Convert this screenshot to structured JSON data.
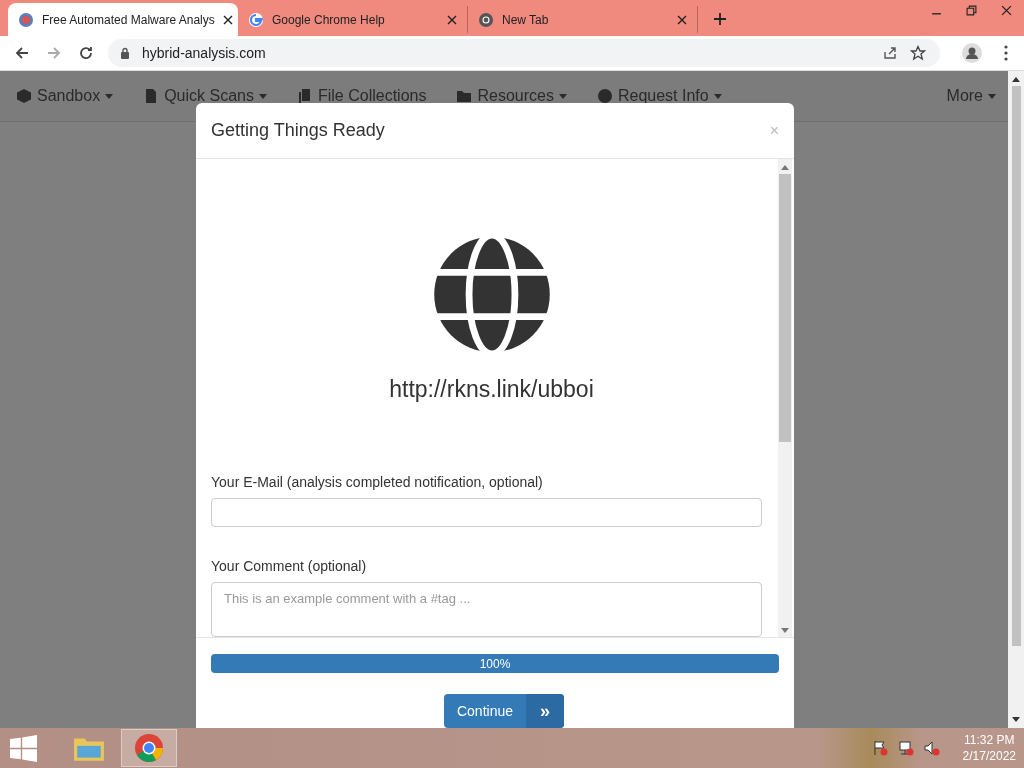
{
  "browser": {
    "tabs": [
      {
        "title": "Free Automated Malware Analys",
        "selected": true
      },
      {
        "title": "Google Chrome Help",
        "selected": false
      },
      {
        "title": "New Tab",
        "selected": false
      }
    ],
    "url": "hybrid-analysis.com"
  },
  "nav": {
    "items": [
      {
        "label": "Sandbox",
        "dropdown": true
      },
      {
        "label": "Quick Scans",
        "dropdown": true
      },
      {
        "label": "File Collections",
        "dropdown": false
      },
      {
        "label": "Resources",
        "dropdown": true
      },
      {
        "label": "Request Info",
        "dropdown": true
      }
    ],
    "more": {
      "label": "More",
      "dropdown": true
    }
  },
  "modal": {
    "title": "Getting Things Ready",
    "close": "×",
    "url": "http://rkns.link/ubboi",
    "email_label": "Your E-Mail (analysis completed notification, optional)",
    "comment_label": "Your Comment (optional)",
    "comment_placeholder": "This is an example comment with a #tag ...",
    "progress": {
      "level": 1,
      "label": "100%"
    },
    "button": "Continue",
    "button_icon": "»"
  },
  "taskbar": {
    "apps": [
      {
        "selected": false
      },
      {
        "selected": true
      }
    ],
    "time": "11:32 PM",
    "date": "2/17/2022"
  }
}
